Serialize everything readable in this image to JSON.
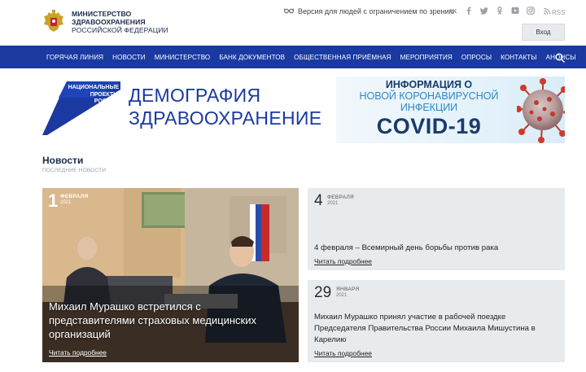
{
  "header": {
    "ministry_line1": "МИНИСТЕРСТВО",
    "ministry_line2": "ЗДРАВООХРАНЕНИЯ",
    "ministry_line3": "РОССИЙСКОЙ ФЕДЕРАЦИИ",
    "vision_link": "Версия для людей с ограничением по зрению",
    "socials": [
      "vk-icon",
      "facebook-icon",
      "twitter-icon",
      "odnoklassniki-icon",
      "youtube-icon",
      "instagram-icon"
    ],
    "rss_label": "RSS",
    "login_label": "Вход"
  },
  "nav": {
    "items": [
      "ГОРЯЧАЯ ЛИНИЯ",
      "НОВОСТИ",
      "МИНИСТЕРСТВО",
      "БАНК ДОКУМЕНТОВ",
      "ОБЩЕСТВЕННАЯ ПРИЁМНАЯ",
      "МЕРОПРИЯТИЯ",
      "ОПРОСЫ",
      "КОНТАКТЫ",
      "АНОНСЫ"
    ]
  },
  "banner_left": {
    "np_line1": "НАЦИОНАЛЬНЫЕ",
    "np_line2": "ПРОЕКТЫ",
    "np_line3": "РОССИИ",
    "title": "ДЕМОГРАФИЯ",
    "subtitle": "ЗДРАВООХРАНЕНИЕ"
  },
  "banner_right": {
    "line1": "ИНФОРМАЦИЯ О",
    "line2": "НОВОЙ КОРОНАВИРУСНОЙ",
    "line3": "ИНФЕКЦИИ",
    "line4": "COVID-19"
  },
  "news": {
    "title": "Новости",
    "subtitle": "ПОСЛЕДНИЕ НОВОСТИ",
    "main": {
      "day": "1",
      "month": "ФЕВРАЛЯ",
      "year": "2021",
      "headline": "Михаил Мурашко встретился с представителями страховых медицинских организаций",
      "read_more": "Читать подробнее"
    },
    "cards": [
      {
        "day": "4",
        "month": "ФЕВРАЛЯ",
        "year": "2021",
        "text": "4 февраля – Всемирный день борьбы против рака",
        "read_more": "Читать подробнее"
      },
      {
        "day": "29",
        "month": "ЯНВАРЯ",
        "year": "2021",
        "text": "Михаил Мурашко принял участие в рабочей поездке Председателя Правительства России Михаила Мишустина в Карелию",
        "read_more": "Читать подробнее"
      }
    ]
  },
  "colors": {
    "nav_bg": "#1a3aa1",
    "brand_blue": "#1a3aa1",
    "covid_dark": "#1a3a6e",
    "covid_light": "#2c86c9",
    "card_bg": "#e8ebee"
  }
}
